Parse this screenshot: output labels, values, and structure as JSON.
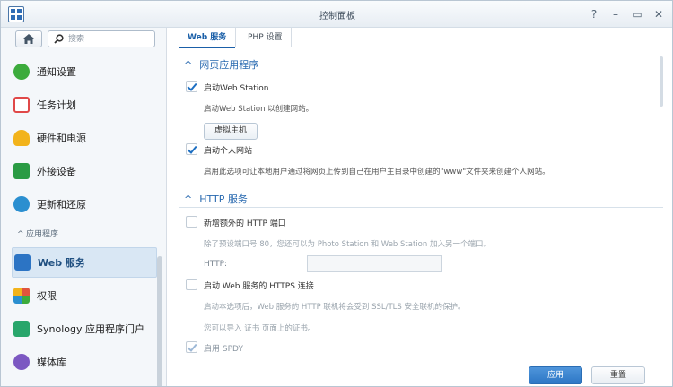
{
  "window": {
    "title": "控制面板",
    "controls": [
      "?",
      "–",
      "▭",
      "✕"
    ]
  },
  "sidebar": {
    "search_placeholder": "搜索",
    "items": [
      {
        "label": "通知设置",
        "icon": "chat-bubble-icon",
        "color": "#3cab3c"
      },
      {
        "label": "任务计划",
        "icon": "calendar-check-icon",
        "color": "#e04848"
      },
      {
        "label": "硬件和电源",
        "icon": "lightbulb-icon",
        "color": "#f2b31b"
      },
      {
        "label": "外接设备",
        "icon": "upload-icon",
        "color": "#2a9b44"
      },
      {
        "label": "更新和还原",
        "icon": "refresh-icon",
        "color": "#2b8fd0"
      }
    ],
    "section_label": "应用程序",
    "app_items": [
      {
        "label": "Web 服务",
        "icon": "web-globe-icon",
        "color": "#2c74c4"
      },
      {
        "label": "权限",
        "icon": "windows-grid-icon",
        "color": "#e0543d"
      },
      {
        "label": "Synology 应用程序门户",
        "icon": "portal-icon",
        "color": "#28a66b"
      },
      {
        "label": "媒体库",
        "icon": "media-library-icon",
        "color": "#7c58c2"
      }
    ]
  },
  "tabs": [
    {
      "label": "Web 服务",
      "active": true
    },
    {
      "label": "PHP 设置",
      "active": false
    }
  ],
  "web_apps": {
    "title": "网页应用程序",
    "enable_web_station": {
      "label": "启动Web Station",
      "checked": true
    },
    "web_station_desc": "启动Web Station 以创建网站。",
    "virtual_host_button": "虚拟主机",
    "enable_personal_site": {
      "label": "启动个人网站",
      "checked": true
    },
    "personal_site_desc": "启用此选项可让本地用户通过将网页上传到自己在用户主目录中创建的\"www\"文件夹来创建个人网站。"
  },
  "http_service": {
    "title": "HTTP 服务",
    "extra_port": {
      "label": "新增额外的 HTTP 端口",
      "checked": false
    },
    "extra_port_desc": "除了预设端口号 80，您还可以为 Photo Station 和 Web Station 加入另一个端口。",
    "http_label": "HTTP:",
    "http_value": "",
    "https": {
      "label": "启动 Web 服务的 HTTPS 连接",
      "checked": false
    },
    "https_desc": "启动本选项后，Web 服务的 HTTP 联机将会受到 SSL/TLS 安全联机的保护。",
    "cert_desc": "您可以导入 证书 页面上的证书。",
    "spdy": {
      "label": "启用 SPDY",
      "checked": true
    }
  },
  "footer": {
    "apply_label": "应用",
    "reset_label": "重置"
  },
  "colors": {
    "accent": "#2a6ab0",
    "primary_button": "#2d77c5"
  }
}
